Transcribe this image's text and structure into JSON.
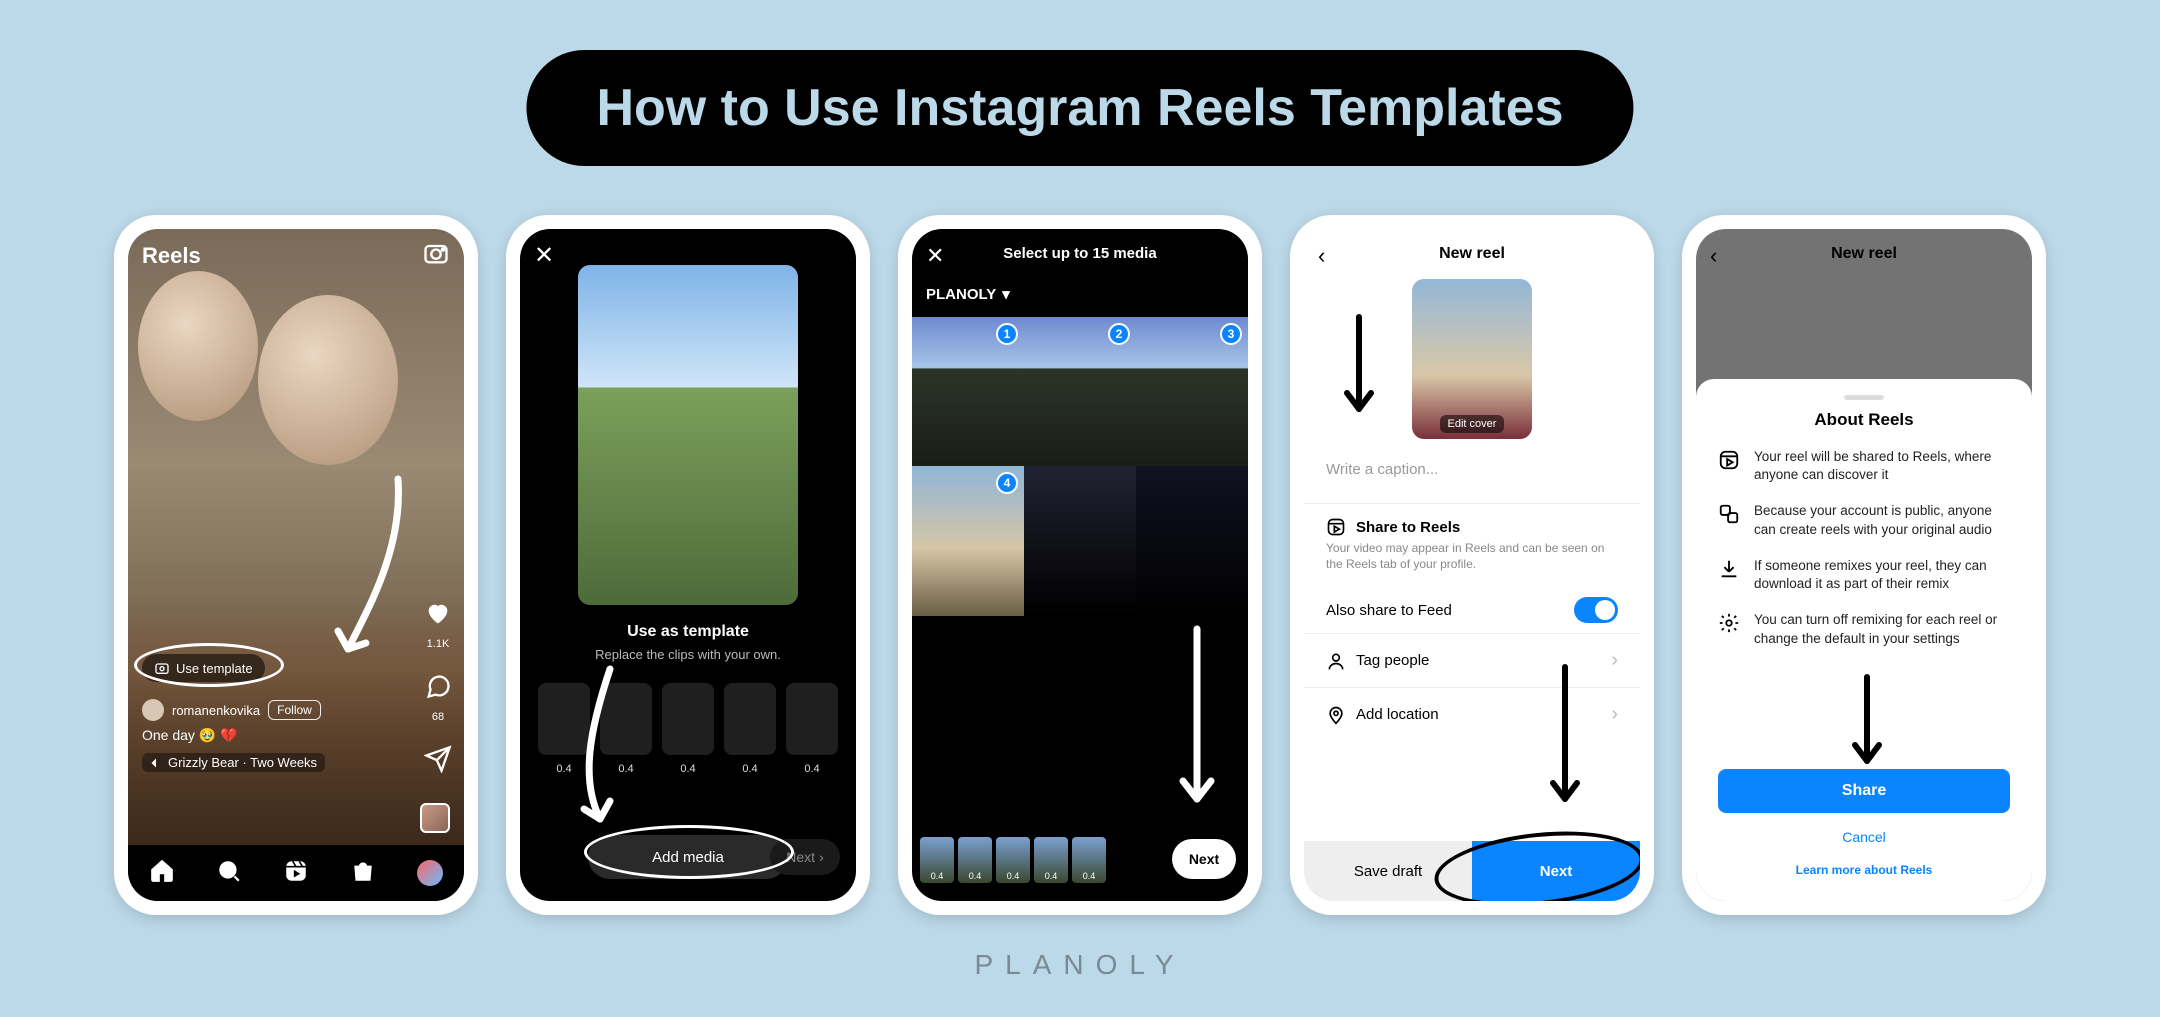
{
  "title": "How to Use Instagram Reels Templates",
  "brand": "PLANOLY",
  "phone1": {
    "header": "Reels",
    "use_template": "Use template",
    "username": "romanenkovika",
    "follow": "Follow",
    "caption": "One day 🥹 💔",
    "audio": "Grizzly Bear · Two Weeks",
    "likes": "1.1K",
    "comments": "68"
  },
  "phone2": {
    "title": "Use as template",
    "subtitle": "Replace the clips with your own.",
    "durations": [
      "0.4",
      "0.4",
      "0.4",
      "0.4",
      "0.4"
    ],
    "add_media": "Add media",
    "next": "Next"
  },
  "phone3": {
    "title": "Select up to 15 media",
    "album": "PLANOLY",
    "badges": [
      "1",
      "2",
      "3",
      "4"
    ],
    "thumb_durations": [
      "0.4",
      "0.4",
      "0.4",
      "0.4",
      "0.4"
    ],
    "next": "Next"
  },
  "phone4": {
    "title": "New reel",
    "edit_cover": "Edit cover",
    "caption_placeholder": "Write a caption...",
    "share_reels_label": "Share to Reels",
    "share_reels_desc": "Your video may appear in Reels and can be seen on the Reels tab of your profile.",
    "also_feed": "Also share to Feed",
    "tag_people": "Tag people",
    "add_location": "Add location",
    "save_draft": "Save draft",
    "next": "Next"
  },
  "phone5": {
    "title_bg": "New reel",
    "sheet_title": "About Reels",
    "items": [
      "Your reel will be shared to Reels, where anyone can discover it",
      "Because your account is public, anyone can create reels with your original audio",
      "If someone remixes your reel, they can download it as part of their remix",
      "You can turn off remixing for each reel or change the default in your settings"
    ],
    "share": "Share",
    "cancel": "Cancel",
    "learn_more": "Learn more about Reels"
  }
}
